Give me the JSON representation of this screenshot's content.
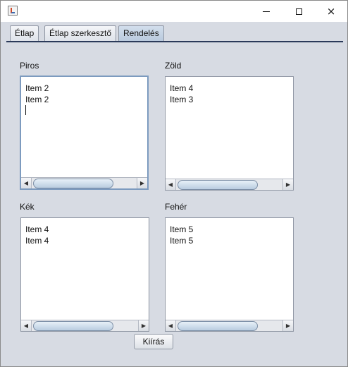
{
  "window": {
    "title": "",
    "icon": "java-app-icon",
    "controls": {
      "minimize": "minimize-icon",
      "maximize": "maximize-icon",
      "close": "×"
    }
  },
  "tabs": [
    {
      "label": "Étlap",
      "active": false
    },
    {
      "label": "Étlap szerkesztő",
      "active": false
    },
    {
      "label": "Rendelés",
      "active": true
    }
  ],
  "lists": [
    {
      "label": "Piros",
      "items": [
        "Item 2",
        "Item 2"
      ],
      "focused": true
    },
    {
      "label": "Zöld",
      "items": [
        "Item 4",
        "Item 3"
      ],
      "focused": false
    },
    {
      "label": "Kék",
      "items": [
        "Item 4",
        "Item 4"
      ],
      "focused": false
    },
    {
      "label": "Fehér",
      "items": [
        "Item 5",
        "Item 5"
      ],
      "focused": false
    }
  ],
  "scrollbar": {
    "left_arrow": "◀",
    "right_arrow": "▶"
  },
  "actions": {
    "print_label": "Kiírás"
  }
}
